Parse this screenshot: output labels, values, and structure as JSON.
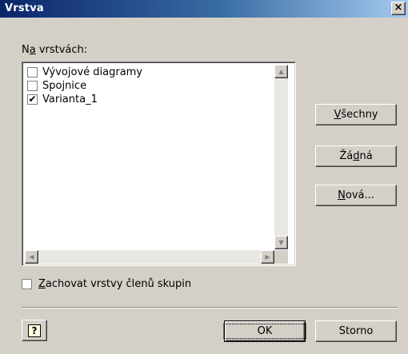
{
  "window": {
    "title": "Vrstva",
    "close_label": "×"
  },
  "layers_label": {
    "prefix": "N",
    "accel": "a",
    "rest": " vrstvách:"
  },
  "layers": [
    {
      "label": "Vývojové diagramy",
      "checked": false
    },
    {
      "label": "Spojnice",
      "checked": false
    },
    {
      "label": "Varianta_1",
      "checked": true
    }
  ],
  "buttons": {
    "all": {
      "accel": "V",
      "rest": "šechny"
    },
    "none": {
      "pre": "Žá",
      "accel": "d",
      "rest": "ná"
    },
    "new": {
      "accel": "N",
      "rest": "ová..."
    },
    "ok": "OK",
    "cancel": "Storno"
  },
  "keep_members": {
    "accel": "Z",
    "rest": "achovat vrstvy členů skupin",
    "checked": false
  },
  "icons": {
    "check": "✔",
    "help": "?",
    "arrow_up": "▲",
    "arrow_down": "▼",
    "arrow_left": "◀",
    "arrow_right": "▶"
  }
}
